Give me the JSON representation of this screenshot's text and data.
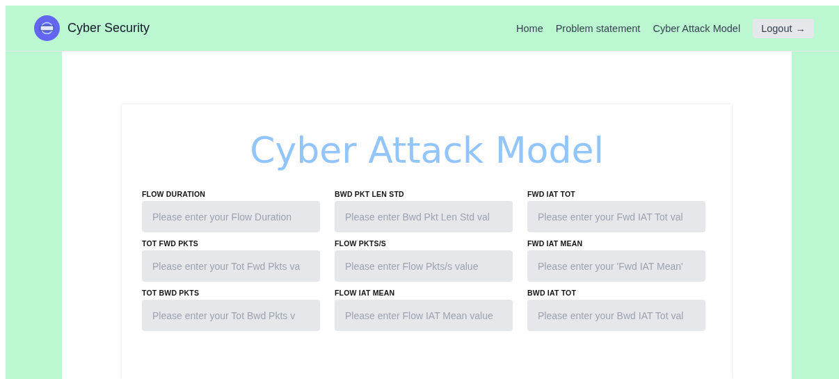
{
  "navbar": {
    "brand": "Cyber Security",
    "links": [
      "Home",
      "Problem statement",
      "Cyber Attack Model"
    ],
    "logout": "Logout",
    "logout_icon": "→"
  },
  "form": {
    "title": "Cyber Attack Model",
    "fields": [
      {
        "label": "FLOW DURATION",
        "placeholder": "Please enter your Flow Duration"
      },
      {
        "label": "BWD PKT LEN STD",
        "placeholder": "Please enter Bwd Pkt Len Std val"
      },
      {
        "label": "FWD IAT TOT",
        "placeholder": "Please enter your Fwd IAT Tot val"
      },
      {
        "label": "TOT FWD PKTS",
        "placeholder": "Please enter your Tot Fwd Pkts va"
      },
      {
        "label": "FLOW PKTS/S",
        "placeholder": "Please enter Flow Pkts/s value"
      },
      {
        "label": "FWD IAT MEAN",
        "placeholder": "Please enter your 'Fwd IAT Mean'"
      },
      {
        "label": "TOT BWD PKTS",
        "placeholder": "Please enter your Tot Bwd Pkts v"
      },
      {
        "label": "FLOW IAT MEAN",
        "placeholder": "Please enter Flow IAT Mean value"
      },
      {
        "label": "BWD IAT TOT",
        "placeholder": "Please enter your Bwd IAT Tot val"
      }
    ]
  }
}
